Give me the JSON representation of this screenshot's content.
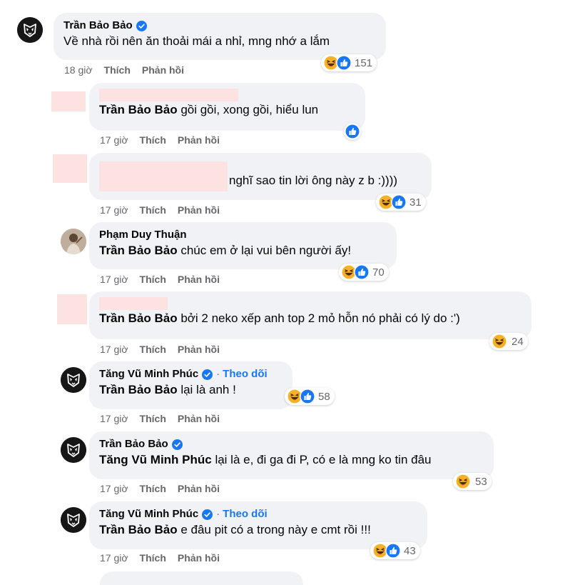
{
  "comments": [
    {
      "author": "Trần Bảo Bảo",
      "verified": true,
      "follow": "",
      "mention": "",
      "text": "Về nhà rồi nên ăn thoải mái a nhỉ, mng nhớ a lắm",
      "time": "18 giờ",
      "like": "Thích",
      "reply": "Phản hồi",
      "reactions": [
        "haha",
        "like"
      ],
      "count": "151"
    },
    {
      "author": "",
      "verified": false,
      "follow": "",
      "mention": "Trần Bảo Bảo",
      "text": " gồi gồi, xong gồi, hiểu lun",
      "time": "17 giờ",
      "like": "Thích",
      "reply": "Phản hồi",
      "reactions": [
        "like"
      ],
      "count": ""
    },
    {
      "author": "",
      "verified": false,
      "follow": "",
      "mention": "",
      "text": "nghĩ sao tin lời ông này z b :))))",
      "time": "17 giờ",
      "like": "Thích",
      "reply": "Phản hồi",
      "reactions": [
        "haha",
        "like"
      ],
      "count": "31"
    },
    {
      "author": "Phạm Duy Thuận",
      "verified": false,
      "follow": "",
      "mention": "Trần Bảo Bảo",
      "text": " chúc em ở lại vui bên người ấy!",
      "time": "17 giờ",
      "like": "Thích",
      "reply": "Phản hồi",
      "reactions": [
        "haha",
        "like"
      ],
      "count": "70"
    },
    {
      "author": "",
      "verified": false,
      "follow": "",
      "mention": "Trần Bảo Bảo",
      "text": " bởi 2 neko xếp anh top 2 mỏ hỗn nó phải có lý do :')",
      "time": "17 giờ",
      "like": "Thích",
      "reply": "Phản hồi",
      "reactions": [
        "haha"
      ],
      "count": "24"
    },
    {
      "author": "Tăng Vũ Minh Phúc",
      "verified": true,
      "follow": "Theo dõi",
      "mention": "Trần Bảo Bảo",
      "text": " lại là anh !",
      "time": "17 giờ",
      "like": "Thích",
      "reply": "Phản hồi",
      "reactions": [
        "haha",
        "like"
      ],
      "count": "58"
    },
    {
      "author": "Trần Bảo Bảo",
      "verified": true,
      "follow": "",
      "mention": "Tăng Vũ Minh Phúc",
      "text": " lại là e, đi ga đi P, có e là mng ko tin đâu",
      "time": "17 giờ",
      "like": "Thích",
      "reply": "Phản hồi",
      "reactions": [
        "haha"
      ],
      "count": "53"
    },
    {
      "author": "Tăng Vũ Minh Phúc",
      "verified": true,
      "follow": "Theo dõi",
      "mention": "Trần Bảo Bảo",
      "text": " e đâu pit có a trong này e cmt rồi !!!",
      "time": "17 giờ",
      "like": "Thích",
      "reply": "Phản hồi",
      "reactions": [
        "haha",
        "like"
      ],
      "count": "43"
    }
  ],
  "colors": {
    "accent": "#1877f2",
    "bubble": "#f0f2f5",
    "muted": "#65676b",
    "redacted": "#fce3e2"
  },
  "icons": {
    "verified": "verified-badge-icon",
    "haha": "haha-reaction-icon",
    "like": "like-reaction-icon",
    "avatar": "mask-logo-avatar-icon"
  }
}
